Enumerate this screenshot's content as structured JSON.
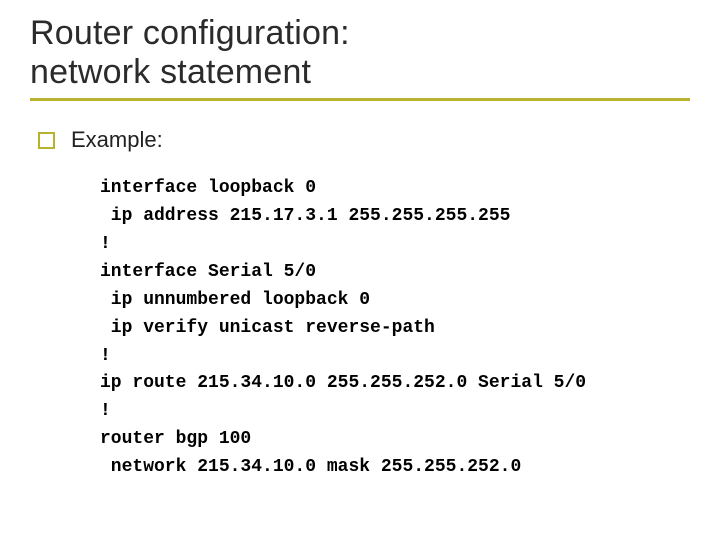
{
  "title_line1": "Router configuration:",
  "title_line2": "network statement",
  "bullet_label": "Example:",
  "code": {
    "l1": "interface loopback 0",
    "l2": " ip address 215.17.3.1 255.255.255.255",
    "l3": "!",
    "l4": "interface Serial 5/0",
    "l5": " ip unnumbered loopback 0",
    "l6": " ip verify unicast reverse-path",
    "l7": "!",
    "l8": "ip route 215.34.10.0 255.255.252.0 Serial 5/0",
    "l9": "!",
    "l10": "router bgp 100",
    "l11": " network 215.34.10.0 mask 255.255.252.0"
  }
}
